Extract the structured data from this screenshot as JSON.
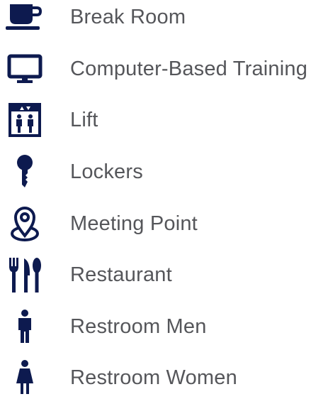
{
  "legend": {
    "items": [
      {
        "icon": "coffee-cup-icon",
        "label": "Break Room"
      },
      {
        "icon": "monitor-icon",
        "label": "Computer-Based Training"
      },
      {
        "icon": "elevator-icon",
        "label": "Lift"
      },
      {
        "icon": "key-icon",
        "label": "Lockers"
      },
      {
        "icon": "map-pin-icon",
        "label": "Meeting Point"
      },
      {
        "icon": "cutlery-icon",
        "label": "Restaurant"
      },
      {
        "icon": "man-icon",
        "label": "Restroom Men"
      },
      {
        "icon": "woman-icon",
        "label": "Restroom Women"
      }
    ],
    "icon_color": "#0d1a4f",
    "text_color": "#55565a"
  }
}
